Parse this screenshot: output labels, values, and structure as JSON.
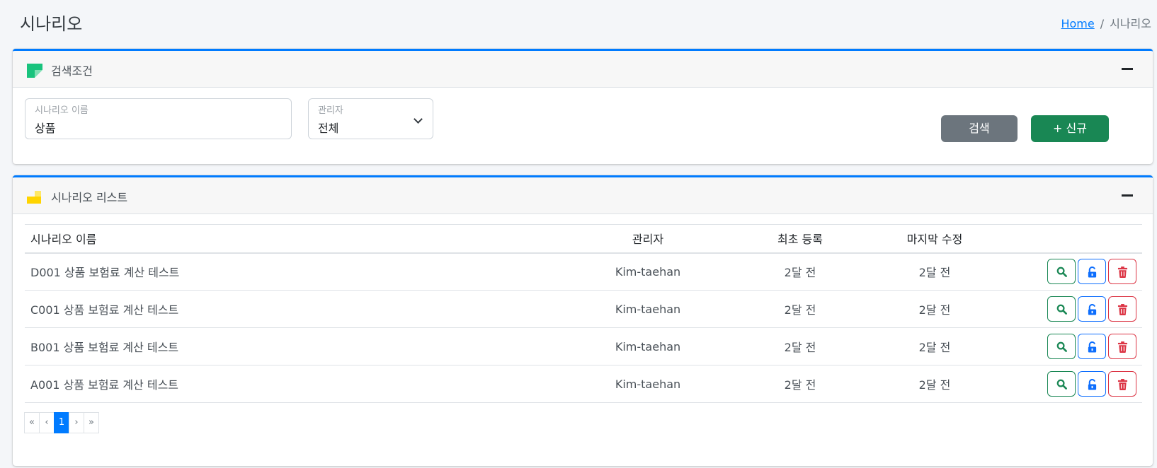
{
  "page": {
    "title": "시나리오",
    "breadcrumb": {
      "home": "Home",
      "separator": "/",
      "current": "시나리오"
    }
  },
  "search_card": {
    "title": "검색조건",
    "name_field": {
      "label": "시나리오 이름",
      "value": "상품"
    },
    "manager_field": {
      "label": "관리자",
      "value": "전체"
    },
    "search_button": "검색",
    "new_button": "+ 신규"
  },
  "list_card": {
    "title": "시나리오 리스트",
    "columns": {
      "name": "시나리오 이름",
      "manager": "관리자",
      "registered": "최초 등록",
      "modified": "마지막 수정"
    },
    "rows": [
      {
        "name": "D001 상품 보험료 계산 테스트",
        "manager": "Kim-taehan",
        "registered": "2달 전",
        "modified": "2달 전"
      },
      {
        "name": "C001 상품 보험료 계산 테스트",
        "manager": "Kim-taehan",
        "registered": "2달 전",
        "modified": "2달 전"
      },
      {
        "name": "B001 상품 보험료 계산 테스트",
        "manager": "Kim-taehan",
        "registered": "2달 전",
        "modified": "2달 전"
      },
      {
        "name": "A001 상품 보험료 계산 테스트",
        "manager": "Kim-taehan",
        "registered": "2달 전",
        "modified": "2달 전"
      }
    ],
    "pagination": {
      "first": "«",
      "prev": "‹",
      "current": "1",
      "next": "›",
      "last": "»"
    }
  },
  "colors": {
    "primary": "#007bff",
    "search_button": "#6c757d",
    "new_button": "#198754",
    "view_action": "#198754",
    "lock_action": "#0d6efd",
    "delete_action": "#dc3545"
  },
  "icons": {
    "search_card_icon": "flag-icon",
    "list_card_icon": "stairs-icon",
    "row_actions": [
      "search-icon",
      "unlock-icon",
      "trash-icon"
    ]
  }
}
